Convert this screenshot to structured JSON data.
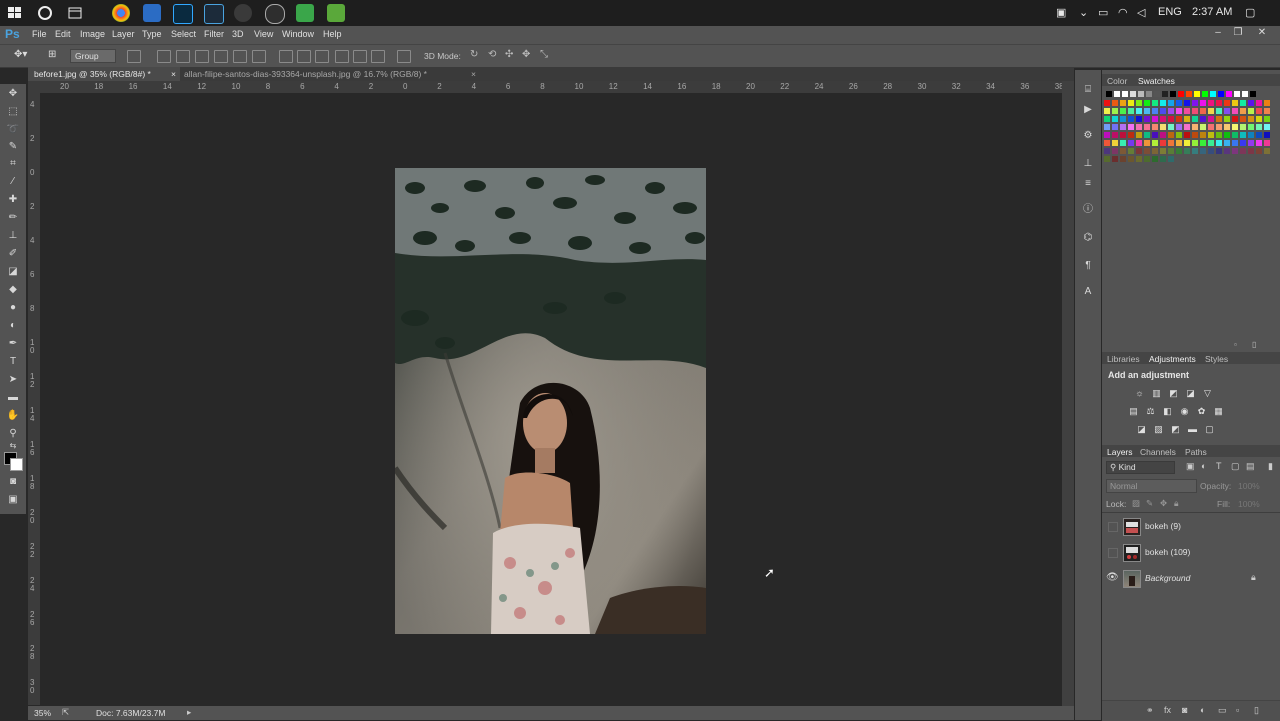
{
  "taskbar": {
    "tray_lang": "ENG",
    "tray_time": "2:37 AM"
  },
  "app": {
    "logo": "Ps",
    "menu": [
      "File",
      "Edit",
      "Image",
      "Layer",
      "Type",
      "Select",
      "Filter",
      "3D",
      "View",
      "Window",
      "Help"
    ]
  },
  "options": {
    "auto_select_mode": "Group",
    "three_d_mode_label": "3D Mode:"
  },
  "tabs": [
    {
      "label": "before1.jpg @ 35% (RGB/8#) *",
      "active": true
    },
    {
      "label": "allan-filipe-santos-dias-393364-unsplash.jpg @ 16.7% (RGB/8) *",
      "active": false
    }
  ],
  "ruler_top": [
    "20",
    "18",
    "16",
    "14",
    "12",
    "10",
    "8",
    "6",
    "4",
    "2",
    "0",
    "2",
    "4",
    "6",
    "8",
    "10",
    "12",
    "14",
    "16",
    "18",
    "20",
    "22",
    "24",
    "26",
    "28",
    "30",
    "32",
    "34",
    "36",
    "38"
  ],
  "ruler_left": [
    "4",
    "2",
    "0",
    "2",
    "4",
    "6",
    "8",
    "1\n0",
    "1\n2",
    "1\n4",
    "1\n6",
    "1\n8",
    "2\n0",
    "2\n2",
    "2\n4",
    "2\n6",
    "2\n8",
    "3\n0"
  ],
  "status": {
    "zoom": "35%",
    "doc": "Doc: 7.63M/23.7M"
  },
  "panels": {
    "color_tabs": [
      "Color",
      "Swatches"
    ],
    "adjust_tabs": [
      "Libraries",
      "Adjustments",
      "Styles"
    ],
    "add_adjustment": "Add an adjustment",
    "layer_tabs": [
      "Layers",
      "Channels",
      "Paths"
    ],
    "kind_label": "Kind",
    "blend_mode": "Normal",
    "opacity_label": "Opacity:",
    "opacity_value": "100%",
    "lock_label": "Lock:",
    "fill_label": "Fill:",
    "fill_value": "100%"
  },
  "layers": [
    {
      "name": "bokeh (9)",
      "visible": false
    },
    {
      "name": "bokeh (109)",
      "visible": false
    },
    {
      "name": "Background",
      "visible": true,
      "locked": true
    }
  ],
  "colors": {
    "ui_dark": "#535353",
    "canvas_bg": "#282828",
    "accent": "#4aa3df"
  }
}
